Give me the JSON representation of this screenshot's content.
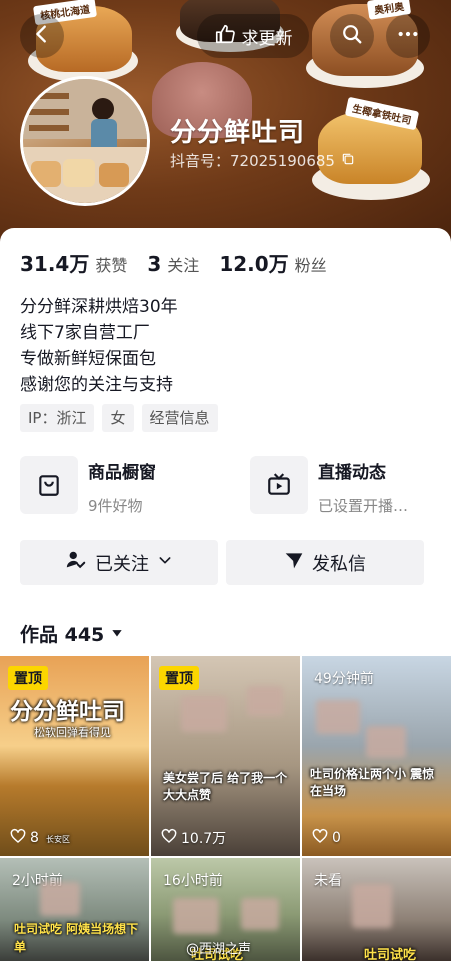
{
  "header": {
    "update_label": "求更新",
    "banner_badges": [
      "核桃北海道",
      "奥利奥",
      "生椰拿铁吐司"
    ]
  },
  "profile": {
    "nickname": "分分鲜吐司",
    "douyin_id": "抖音号：72025190685",
    "stats": [
      {
        "num": "31.4万",
        "label": "获赞"
      },
      {
        "num": "3",
        "label": "关注"
      },
      {
        "num": "12.0万",
        "label": "粉丝"
      }
    ],
    "bio": [
      "分分鲜深耕烘焙30年",
      "线下7家自营工厂",
      "专做新鲜短保面包",
      "感谢您的关注与支持"
    ],
    "tags": [
      "IP：浙江",
      "女",
      "经营信息"
    ]
  },
  "features": [
    {
      "title": "商品橱窗",
      "sub": "9件好物",
      "icon": "shopping-bag-icon"
    },
    {
      "title": "直播动态",
      "sub": "已设置开播…",
      "icon": "tv-icon"
    }
  ],
  "actions": {
    "follow_label": "已关注",
    "message_label": "发私信"
  },
  "works": {
    "title": "作品 445",
    "tiles": [
      {
        "badge": "置顶",
        "likes": "8",
        "caption": "分分鲜吐司",
        "subcaption": "松软回弹看得见",
        "location": "长安区"
      },
      {
        "badge": "置顶",
        "likes": "10.7万",
        "caption": "美女尝了后 给了我一个大大点赞"
      },
      {
        "time": "49分钟前",
        "likes": "0",
        "caption": "吐司价格让两个小 震惊在当场"
      },
      {
        "time": "2小时前",
        "caption": "吐司试吃 阿姨当场想下单"
      },
      {
        "time": "16小时前",
        "caption": "吐司试吃"
      },
      {
        "time": "未看",
        "caption": "吐司试吃"
      }
    ]
  },
  "watermark": "@西湖之声"
}
